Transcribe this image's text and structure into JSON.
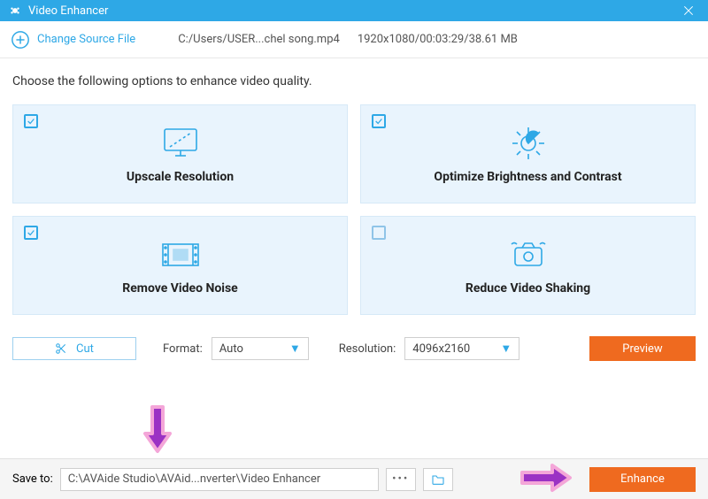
{
  "titlebar": {
    "title": "Video Enhancer"
  },
  "filerow": {
    "change_label": "Change Source File",
    "path": "C:/Users/USER...chel song.mp4",
    "info": "1920x1080/00:03:29/38.61 MB"
  },
  "prompt": "Choose the following options to enhance video quality.",
  "cards": {
    "upscale": {
      "label": "Upscale Resolution"
    },
    "brightness": {
      "label": "Optimize Brightness and Contrast"
    },
    "noise": {
      "label": "Remove Video Noise"
    },
    "shaking": {
      "label": "Reduce Video Shaking"
    }
  },
  "controls": {
    "cut_label": "Cut",
    "format_label": "Format:",
    "format_value": "Auto",
    "resolution_label": "Resolution:",
    "resolution_value": "4096x2160",
    "preview_label": "Preview"
  },
  "footer": {
    "save_label": "Save to:",
    "save_path": "C:\\AVAide Studio\\AVAid...nverter\\Video Enhancer",
    "enhance_label": "Enhance"
  }
}
